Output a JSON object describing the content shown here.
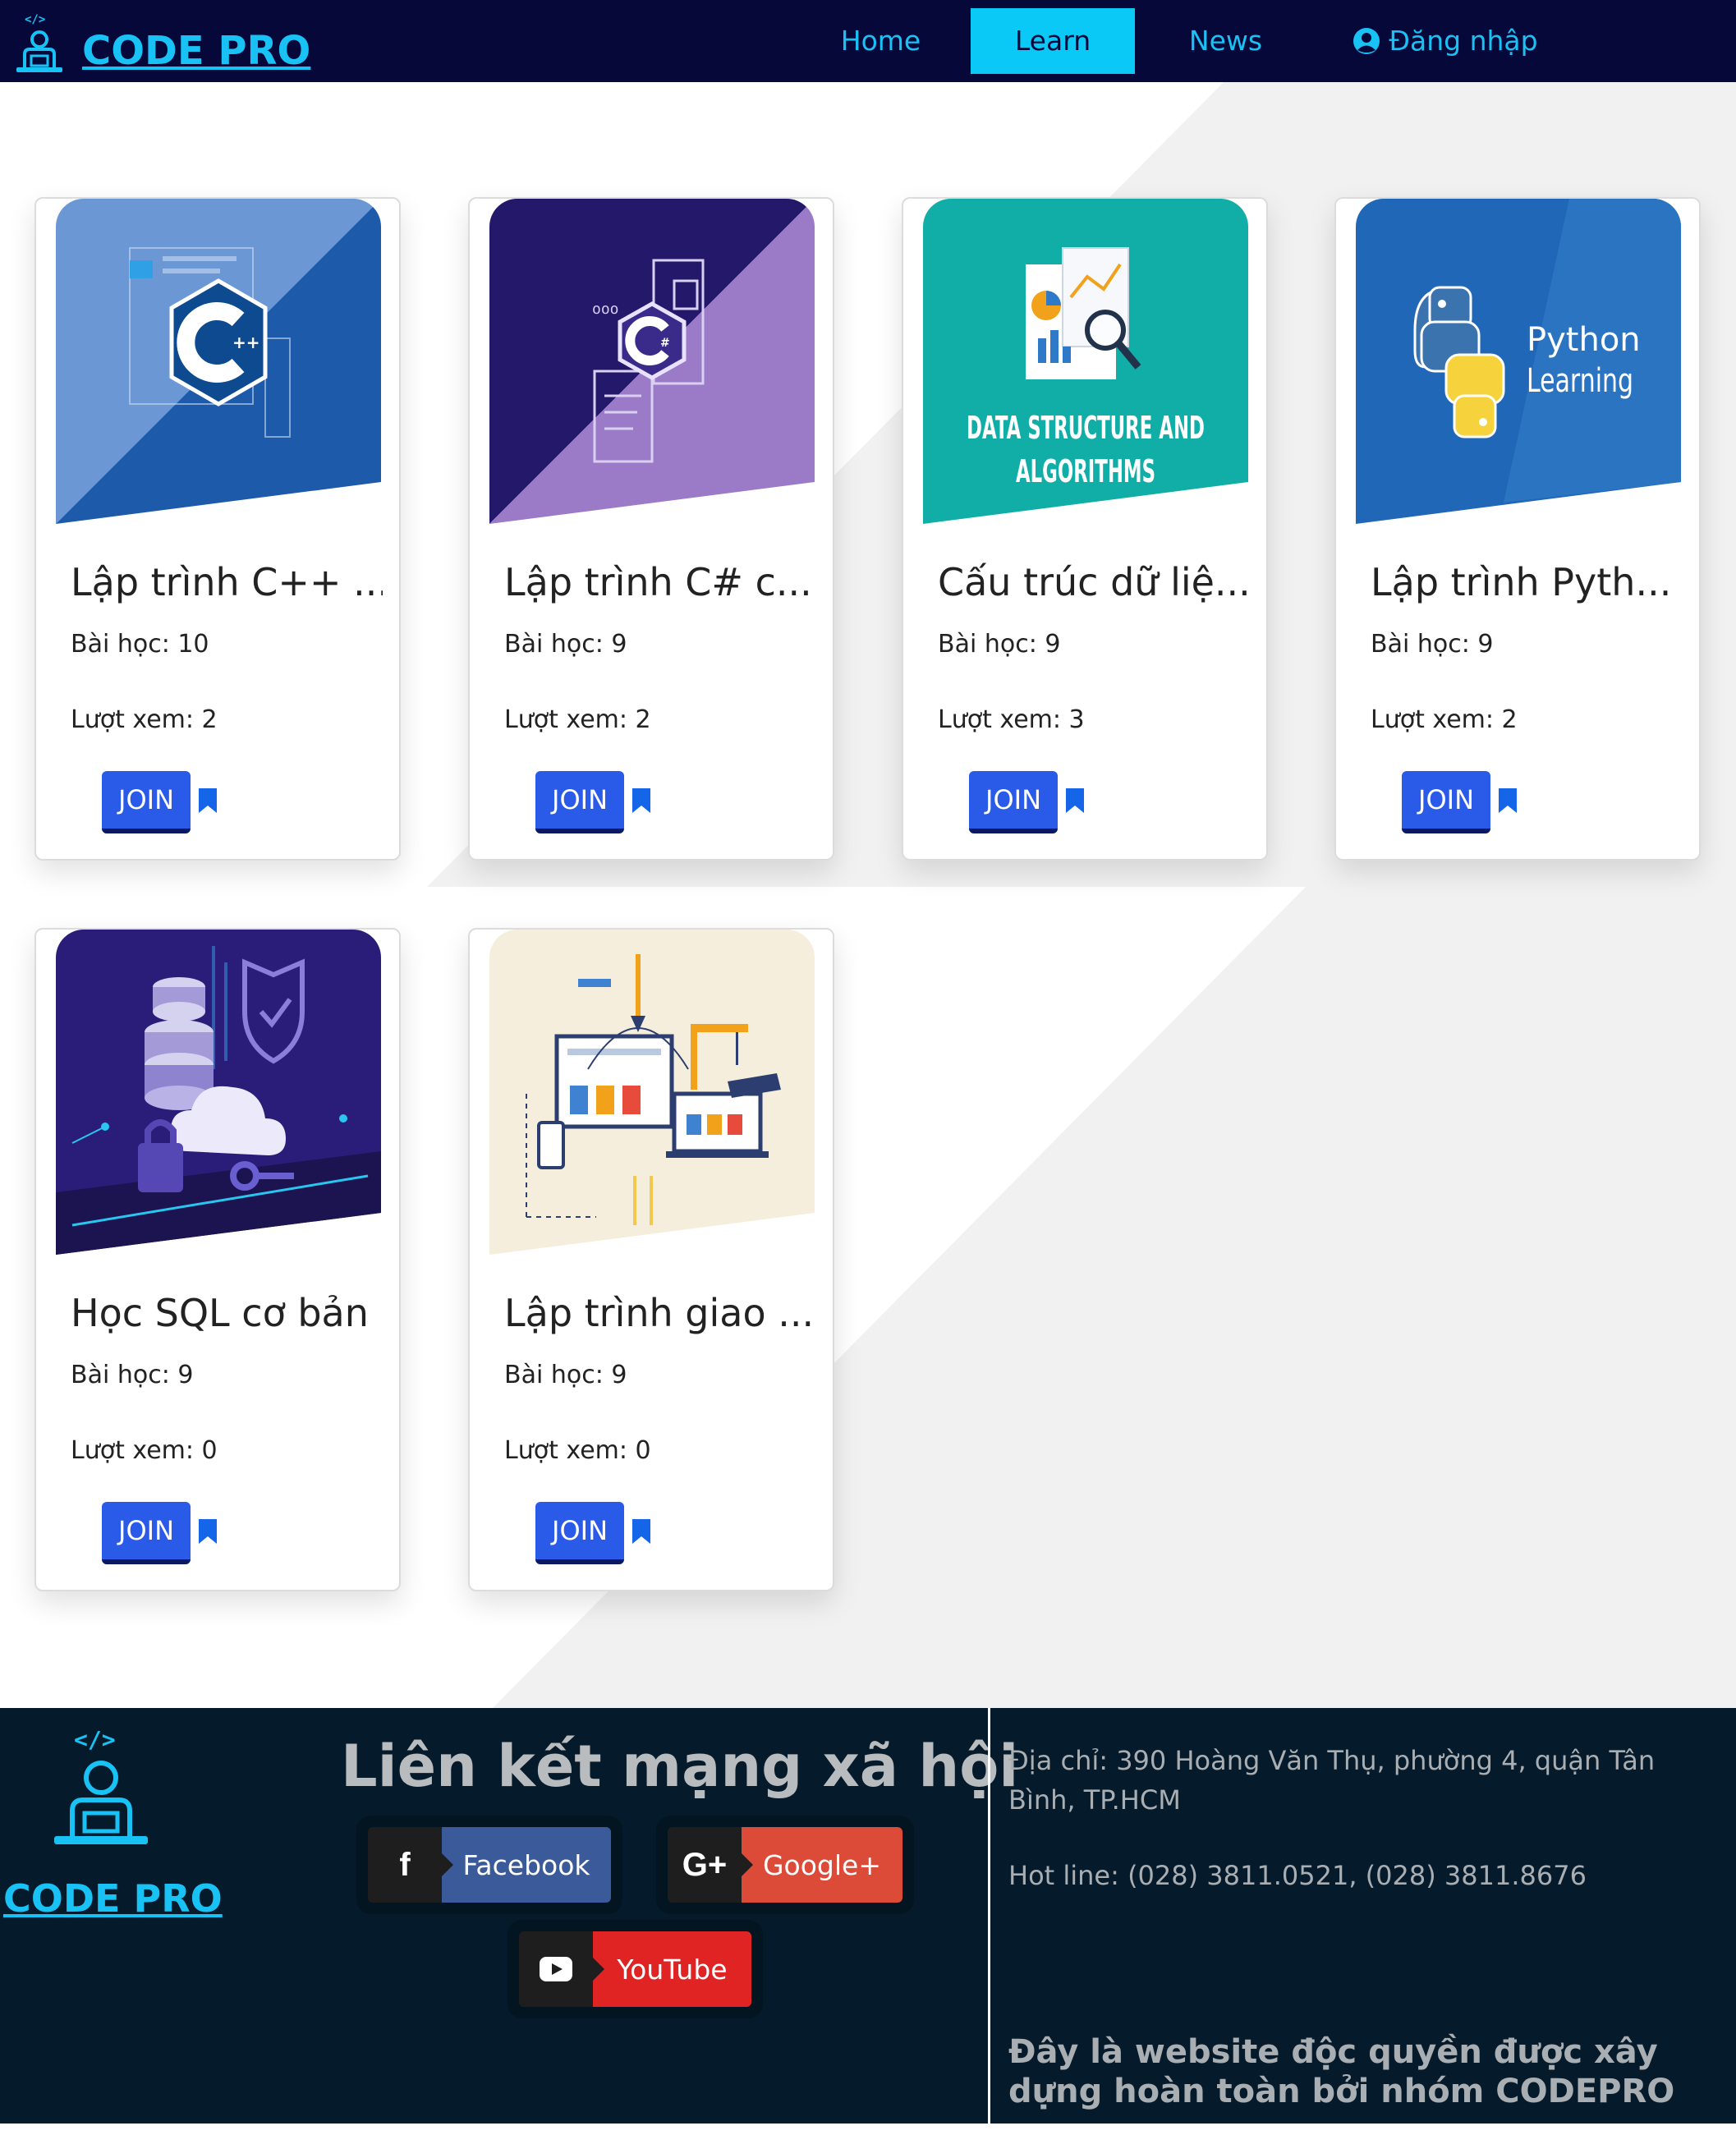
{
  "navbar": {
    "brand": "CODE PRO",
    "items": [
      {
        "label": "Home",
        "active": false
      },
      {
        "label": "Learn",
        "active": true
      },
      {
        "label": "News",
        "active": false
      }
    ],
    "login_label": "Đăng nhập",
    "accent_color": "#19c2f5",
    "bg_color": "#07083a"
  },
  "courses": [
    {
      "title": "Lập trình C++ ...",
      "lessons": "Bài học: 10",
      "views": "Lượt xem: 2",
      "join_label": "JOIN",
      "image_icon": "cpp-logo-icon"
    },
    {
      "title": "Lập trình C# c...",
      "lessons": "Bài học: 9",
      "views": "Lượt xem: 2",
      "join_label": "JOIN",
      "image_icon": "csharp-logo-icon"
    },
    {
      "title": "Cấu trúc dữ liệ...",
      "lessons": "Bài học: 9",
      "views": "Lượt xem: 3",
      "join_label": "JOIN",
      "image_icon": "data-structure-icon",
      "image_caption_line1": "DATA STRUCTURE AND",
      "image_caption_line2": "ALGORITHMS"
    },
    {
      "title": "Lập trình Pyth...",
      "lessons": "Bài học: 9",
      "views": "Lượt xem: 2",
      "join_label": "JOIN",
      "image_icon": "python-logo-icon",
      "image_caption_line1": "Python",
      "image_caption_line2": "Learning"
    },
    {
      "title": "Học SQL cơ bản",
      "lessons": "Bài học: 9",
      "views": "Lượt xem: 0",
      "join_label": "JOIN",
      "image_icon": "database-cloud-icon"
    },
    {
      "title": "Lập trình giao ...",
      "lessons": "Bài học: 9",
      "views": "Lượt xem: 0",
      "join_label": "JOIN",
      "image_icon": "web-design-icon"
    }
  ],
  "footer": {
    "brand": "CODE PRO",
    "social_title": "Liên kết mạng xã hội",
    "social": [
      {
        "label": "Facebook",
        "icon": "facebook-icon",
        "glyph": "f",
        "color": "#3b5a9a"
      },
      {
        "label": "Google+",
        "icon": "google-plus-icon",
        "glyph": "G+",
        "color": "#dc4a38"
      },
      {
        "label": "YouTube",
        "icon": "youtube-icon",
        "glyph": "",
        "color": "#e02424"
      }
    ],
    "address": "Địa chỉ: 390 Hoàng Văn Thụ, phường 4, quận Tân Bình, TP.HCM",
    "hotline": "Hot line: (028) 3811.0521, (028) 3811.8676",
    "copyright": "Đây là website độc quyền được xây dựng hoàn toàn bởi nhóm CODEPRO"
  }
}
